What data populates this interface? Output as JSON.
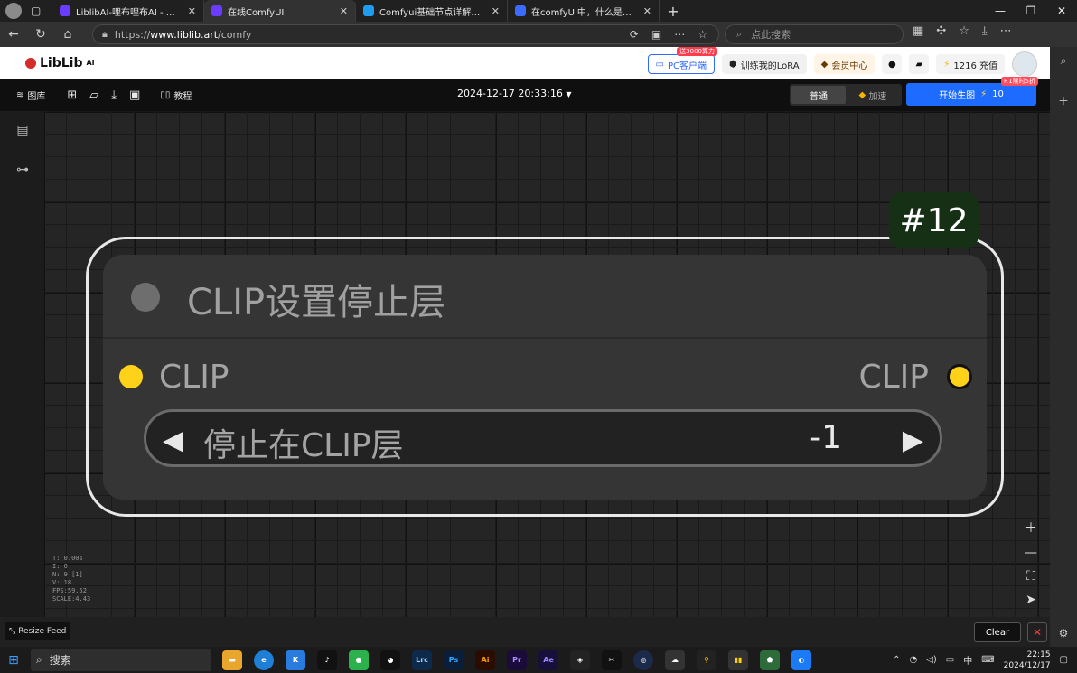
{
  "browser": {
    "tabs": [
      {
        "title": "LiblibAI-哩布哩布AI - 中国领先的",
        "active": false,
        "color": "#6a3cff"
      },
      {
        "title": "在线ComfyUI",
        "active": true,
        "color": "#6a3cff"
      },
      {
        "title": "Comfyui基础节点详解——条件_",
        "active": false,
        "color": "#1f9cf0"
      },
      {
        "title": "在comfyUI中，什么是CLIP设置停",
        "active": false,
        "color": "#3b6cff"
      }
    ],
    "url_prefix": "https://",
    "url_host": "www.liblib.art",
    "url_path": "/comfy",
    "search_placeholder": "点此搜索"
  },
  "site_header": {
    "logo": "LibLib",
    "logo_sup": "AI",
    "pc_client": "PC客户端",
    "pc_badge": "送3000算力",
    "train_lora": "训练我的LoRA",
    "vip": "会员中心",
    "coins": "1216 充值"
  },
  "app_toolbar": {
    "gallery": "图库",
    "tutorial": "教程",
    "timestamp": "2024-12-17 20:33:16",
    "mode_normal": "普通",
    "mode_fast": "加速",
    "generate": "开始生图",
    "generate_cost": "10",
    "promo": "F.1限时5折"
  },
  "node": {
    "id": "#12",
    "title": "CLIP设置停止层",
    "input_label": "CLIP",
    "output_label": "CLIP",
    "widget_label": "停止在CLIP层",
    "widget_value": "-1",
    "input_color": "#ffd21a"
  },
  "stats": [
    "T: 0.00s",
    "I: 0",
    "N: 9 [1]",
    "V: 18",
    "FPS:59.52",
    "SCALE:4.43"
  ],
  "bottom": {
    "resize_feed": "Resize Feed",
    "clear": "Clear"
  },
  "taskbar": {
    "search": "搜索",
    "ime": "中",
    "time": "22:15",
    "date": "2024/12/17"
  }
}
